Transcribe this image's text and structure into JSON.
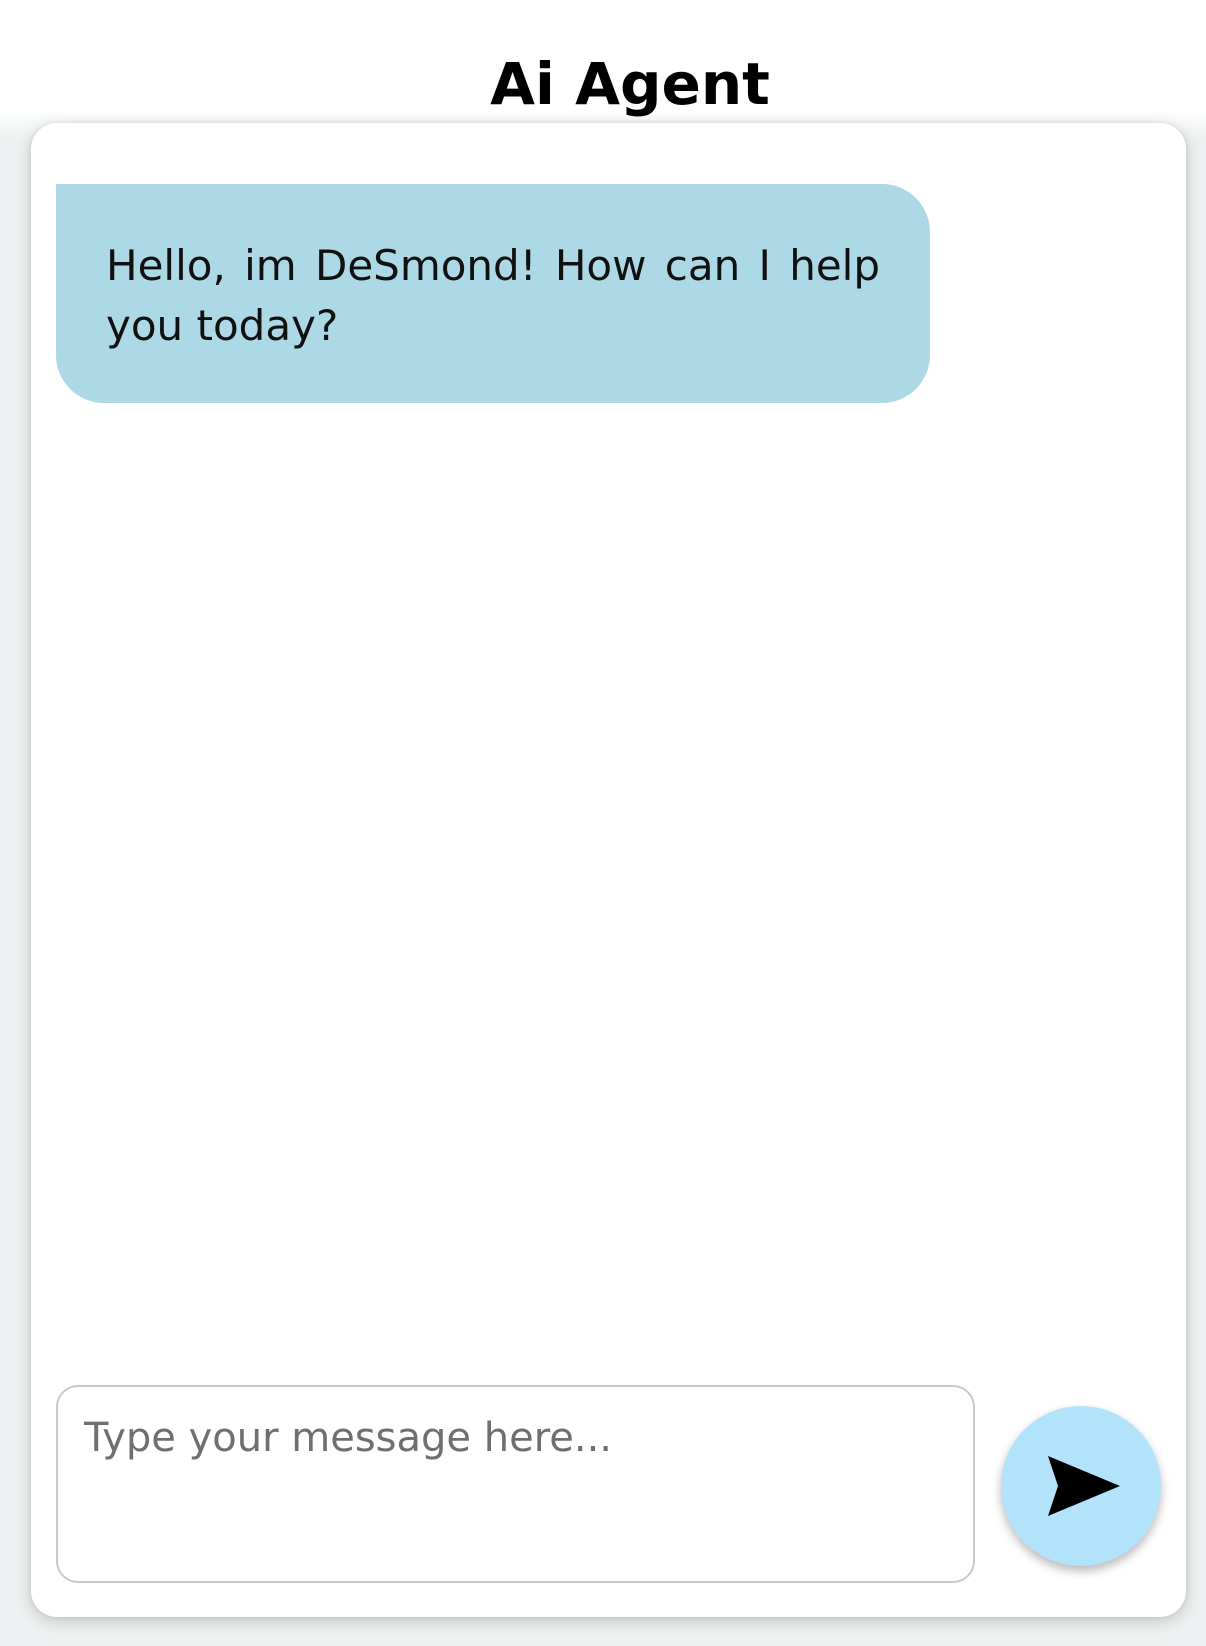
{
  "header": {
    "title": "Ai Agent"
  },
  "chat": {
    "messages": [
      {
        "sender": "bot",
        "text": "Hello, im DeSmond! How can I help you today?"
      }
    ]
  },
  "composer": {
    "placeholder": "Type your message here...",
    "value": "",
    "send_icon": "send-icon"
  },
  "colors": {
    "bot_bubble": "#add8e6",
    "send_button": "#b3e3fa",
    "page_background": "#eef1f1",
    "card_background": "#ffffff"
  }
}
